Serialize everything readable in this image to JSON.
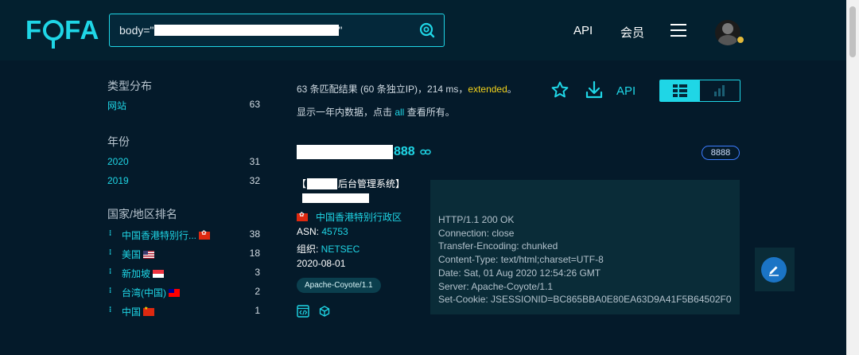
{
  "header": {
    "logo": "FOFA",
    "search_prefix": "body=\"",
    "search_suffix": "\"",
    "nav_api": "API",
    "nav_member": "会员"
  },
  "summary": {
    "text": "63 条匹配结果 (60 条独立IP)，214 ms，",
    "extended": "extended",
    "ext_tail": "。",
    "note_prefix": "显示一年内数据，点击 ",
    "note_all": "all",
    "note_suffix": " 查看所有。",
    "api_link": "API"
  },
  "sidebar": {
    "type_title": "类型分布",
    "type_items": [
      {
        "label": "网站",
        "count": "63"
      }
    ],
    "year_title": "年份",
    "year_items": [
      {
        "label": "2020",
        "count": "31"
      },
      {
        "label": "2019",
        "count": "32"
      }
    ],
    "country_title": "国家/地区排名",
    "country_items": [
      {
        "label": "中国香港特别行...",
        "count": "38"
      },
      {
        "label": "美国",
        "count": "18"
      },
      {
        "label": "新加坡",
        "count": "3"
      },
      {
        "label": "台湾(中国)",
        "count": "2"
      },
      {
        "label": "中国",
        "count": "1"
      }
    ]
  },
  "result": {
    "host_port": "888",
    "port_badge": "8888",
    "title_open": "【",
    "title_close": "后台管理系统】",
    "location": "中国香港特别行政区",
    "asn_label": "ASN: ",
    "asn_value": "45753",
    "org_label": "组织: ",
    "org_value": "NETSEC",
    "date": "2020-08-01",
    "tag": "Apache-Coyote/1.1",
    "headers": [
      "HTTP/1.1 200 OK",
      "Connection: close",
      "Transfer-Encoding: chunked",
      "Content-Type: text/html;charset=UTF-8",
      "Date: Sat, 01 Aug 2020 12:54:26 GMT",
      "Server: Apache-Coyote/1.1",
      "Set-Cookie: JSESSIONID=BC865BBA0E80EA63D9A41F5B64502F0"
    ]
  },
  "colors": {
    "accent": "#1fd6e6",
    "background": "#041a2a",
    "highlight": "#f3d31b"
  }
}
